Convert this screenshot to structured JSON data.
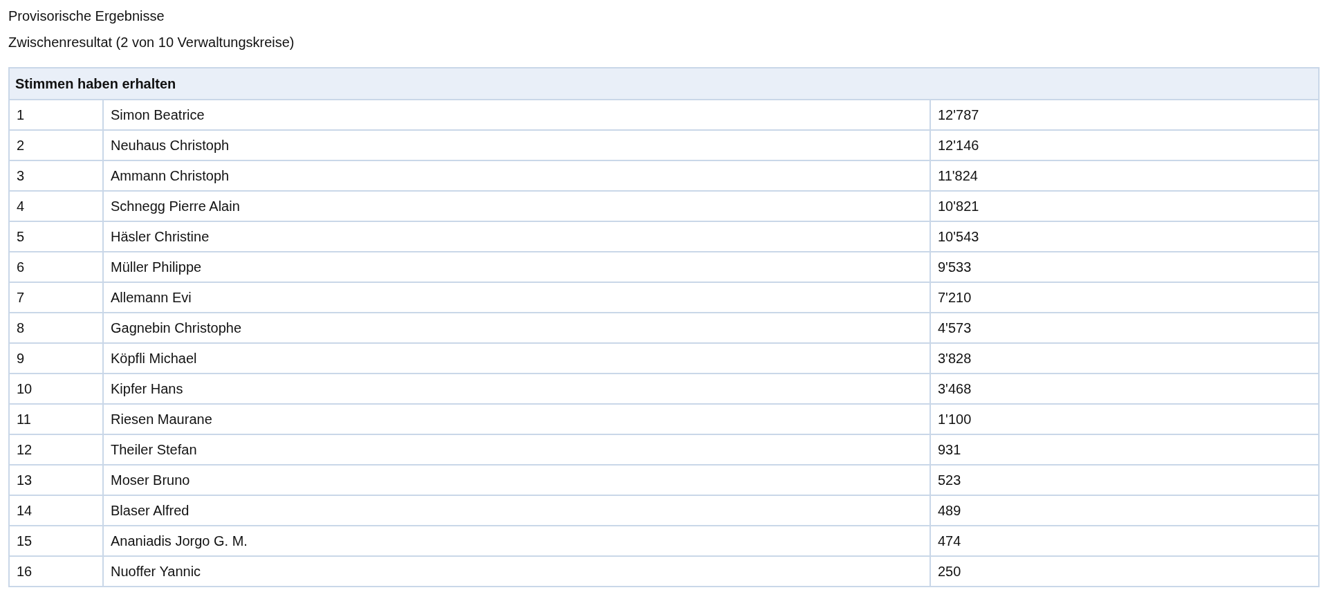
{
  "title": "Provisorische Ergebnisse",
  "subtitle": "Zwischenresultat (2 von 10 Verwaltungskreise)",
  "table": {
    "heading": "Stimmen haben erhalten",
    "rows": [
      {
        "rank": "1",
        "name": "Simon Beatrice",
        "votes": "12'787"
      },
      {
        "rank": "2",
        "name": "Neuhaus Christoph",
        "votes": "12'146"
      },
      {
        "rank": "3",
        "name": "Ammann Christoph",
        "votes": "11'824"
      },
      {
        "rank": "4",
        "name": "Schnegg Pierre Alain",
        "votes": "10'821"
      },
      {
        "rank": "5",
        "name": "Häsler Christine",
        "votes": "10'543"
      },
      {
        "rank": "6",
        "name": "Müller Philippe",
        "votes": "9'533"
      },
      {
        "rank": "7",
        "name": "Allemann Evi",
        "votes": "7'210"
      },
      {
        "rank": "8",
        "name": "Gagnebin Christophe",
        "votes": "4'573"
      },
      {
        "rank": "9",
        "name": "Köpfli Michael",
        "votes": "3'828"
      },
      {
        "rank": "10",
        "name": "Kipfer Hans",
        "votes": "3'468"
      },
      {
        "rank": "11",
        "name": "Riesen Maurane",
        "votes": "1'100"
      },
      {
        "rank": "12",
        "name": "Theiler Stefan",
        "votes": "931"
      },
      {
        "rank": "13",
        "name": "Moser Bruno",
        "votes": "523"
      },
      {
        "rank": "14",
        "name": "Blaser Alfred",
        "votes": "489"
      },
      {
        "rank": "15",
        "name": "Ananiadis Jorgo G. M.",
        "votes": "474"
      },
      {
        "rank": "16",
        "name": "Nuoffer Yannic",
        "votes": "250"
      }
    ]
  }
}
